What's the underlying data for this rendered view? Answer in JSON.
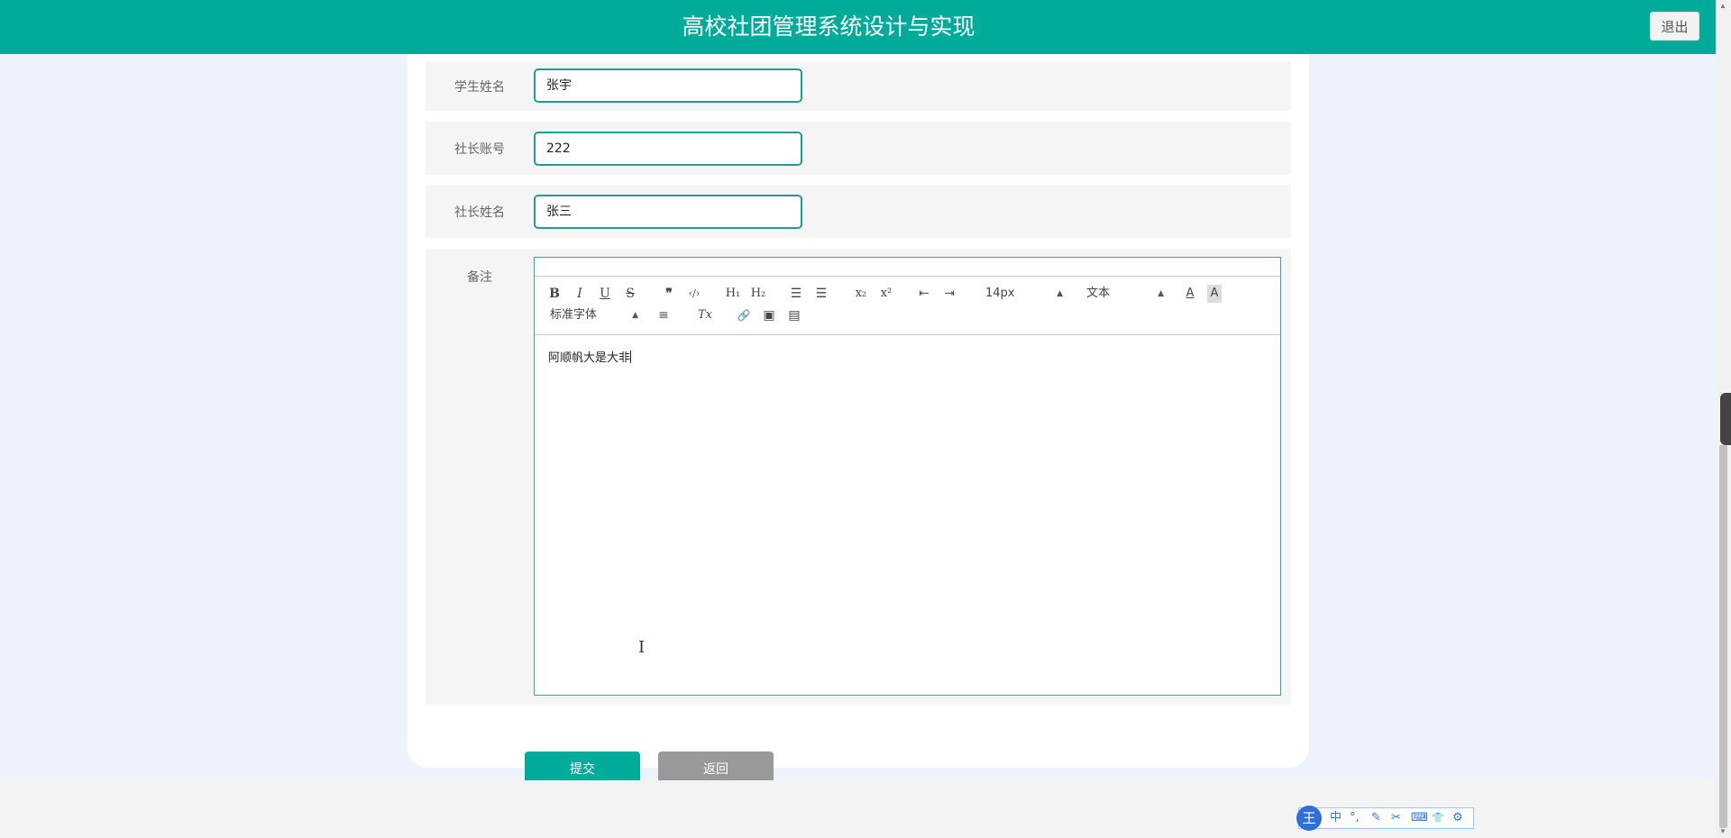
{
  "header": {
    "title": "高校社团管理系统设计与实现",
    "logout_label": "退出"
  },
  "form": {
    "student_name": {
      "label": "学生姓名",
      "value": "张宇"
    },
    "president_account": {
      "label": "社长账号",
      "value": "222"
    },
    "president_name": {
      "label": "社长姓名",
      "value": "张三"
    },
    "remark": {
      "label": "备注",
      "content": "阿顺帆大是大非"
    }
  },
  "editor_toolbar": {
    "bold": "B",
    "italic": "I",
    "underline": "U",
    "strike": "S",
    "blockquote": "❞",
    "code": "‹/›",
    "h1": "H₁",
    "h2": "H₂",
    "ordered_list": "☰",
    "bullet_list": "☰",
    "subscript": "x₂",
    "superscript": "x²",
    "indent_left": "⇤",
    "indent_right": "⇥",
    "size_select": "14px",
    "header_select": "文本",
    "font_color": "A",
    "background_color": "A",
    "font_select": "标准字体",
    "align": "≡",
    "clean": "Tx",
    "link": "🔗",
    "image": "▣",
    "video": "▤"
  },
  "actions": {
    "submit_label": "提交",
    "back_label": "返回"
  },
  "colors": {
    "primary": "#00ab99",
    "back_button": "#999999",
    "page_bg": "#edf2fb"
  },
  "ime_toolbar": {
    "logo": "王",
    "lang": "中",
    "punct": "°,",
    "pen": "✎",
    "cut": "✂",
    "keyboard": "⌨",
    "skin": "👕",
    "settings": "⚙"
  }
}
